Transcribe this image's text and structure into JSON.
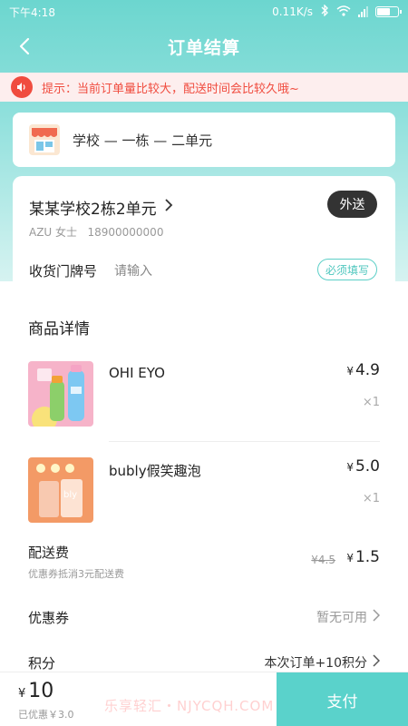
{
  "status_bar": {
    "time": "下午4:18",
    "speed": "0.11K/s"
  },
  "nav": {
    "title": "订单结算"
  },
  "notice": {
    "text": "提示：当前订单量比较大，配送时间会比较久哦~"
  },
  "school": {
    "text": "学校 — 一栋 — 二单元"
  },
  "address": {
    "title": "某某学校2栋2单元",
    "contact": "AZU 女士   18900000000",
    "delivery_mode": "外送",
    "door_label": "收货门牌号",
    "door_placeholder": "请输入",
    "required_tag": "必须填写"
  },
  "products_section": {
    "title": "商品详情"
  },
  "products": [
    {
      "name": "OHI EYO",
      "currency": "¥",
      "price": "4.9",
      "qty": "×1"
    },
    {
      "name": "bubly假笑趣泡",
      "currency": "¥",
      "price": "5.0",
      "qty": "×1"
    }
  ],
  "delivery_fee": {
    "label": "配送费",
    "sub": "优惠券抵消3元配送费",
    "old_price": "¥4.5",
    "currency": "¥",
    "new_price": "1.5"
  },
  "coupon": {
    "label": "优惠券",
    "value": "暂无可用"
  },
  "points": {
    "label": "积分",
    "value": "本次订单+10积分"
  },
  "footer": {
    "currency": "¥",
    "total": "10",
    "saved": "已优惠￥3.0",
    "watermark": "乐享轻汇・NJYCQH.COM",
    "pay_label": "支付"
  },
  "colors": {
    "accent": "#5ad2cb",
    "warning": "#f04c3f"
  }
}
